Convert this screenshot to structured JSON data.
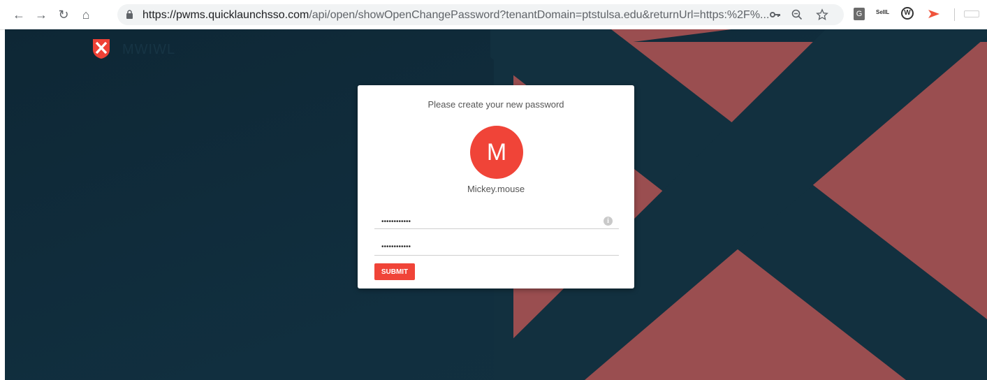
{
  "browser": {
    "url_host": "https://pwms.quicklaunchsso.com",
    "url_path": "/api/open/showOpenChangePassword?tenantDomain=ptstulsa.edu&returnUrl=https:%2F%...",
    "icons": [
      "back-icon",
      "forward-icon",
      "reload-icon",
      "home-icon",
      "lock-icon",
      "key-icon",
      "zoom-icon",
      "star-icon"
    ],
    "extensions": [
      "G",
      "SeIIL",
      "W"
    ]
  },
  "header": {
    "logo_text": "MWIWL"
  },
  "card": {
    "title": "Please create your new password",
    "avatar_letter": "M",
    "username": "Mickey.mouse",
    "password_value": "••••••••••••",
    "confirm_value": "••••••••••••",
    "info_glyph": "i",
    "submit_label": "SUBMIT"
  },
  "colors": {
    "accent": "#f04438",
    "background_dark": "#0f2a3a",
    "background_shape": "#9e5152"
  }
}
